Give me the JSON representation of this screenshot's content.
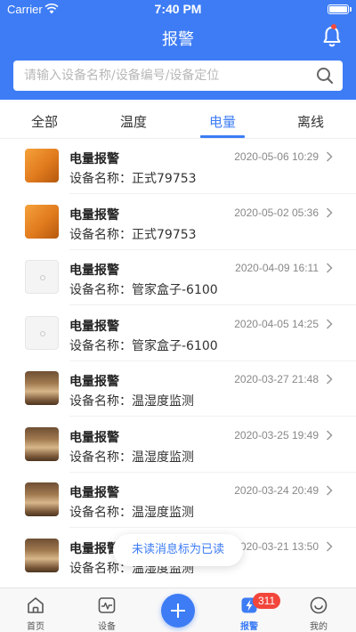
{
  "status_bar": {
    "carrier": "Carrier",
    "time": "7:40 PM"
  },
  "header": {
    "title": "报警"
  },
  "search": {
    "placeholder": "请输入设备名称/设备编号/设备定位"
  },
  "tabs": [
    {
      "label": "全部",
      "active": false
    },
    {
      "label": "温度",
      "active": false
    },
    {
      "label": "电量",
      "active": true
    },
    {
      "label": "离线",
      "active": false
    }
  ],
  "alerts": [
    {
      "title": "电量报警",
      "device": "设备名称：正式79753",
      "time": "2020-05-06 10:29",
      "thumb": "orange"
    },
    {
      "title": "电量报警",
      "device": "设备名称：正式79753",
      "time": "2020-05-02 05:36",
      "thumb": "orange"
    },
    {
      "title": "电量报警",
      "device": "设备名称：管家盒子-6100",
      "time": "2020-04-09 16:11",
      "thumb": "white"
    },
    {
      "title": "电量报警",
      "device": "设备名称：管家盒子-6100",
      "time": "2020-04-05 14:25",
      "thumb": "white"
    },
    {
      "title": "电量报警",
      "device": "设备名称：温湿度监测",
      "time": "2020-03-27 21:48",
      "thumb": "brown"
    },
    {
      "title": "电量报警",
      "device": "设备名称：温湿度监测",
      "time": "2020-03-25 19:49",
      "thumb": "brown"
    },
    {
      "title": "电量报警",
      "device": "设备名称：温湿度监测",
      "time": "2020-03-24 20:49",
      "thumb": "brown"
    },
    {
      "title": "电量报警",
      "device": "设备名称：温湿度监测",
      "time": "2020-03-21 13:50",
      "thumb": "brown"
    }
  ],
  "toast": {
    "label": "未读消息标为已读"
  },
  "tabbar": {
    "home": "首页",
    "device": "设备",
    "alarm": "报警",
    "mine": "我的",
    "alarm_badge": "311"
  },
  "colors": {
    "primary": "#3d7cf5",
    "badge": "#f2463b"
  }
}
